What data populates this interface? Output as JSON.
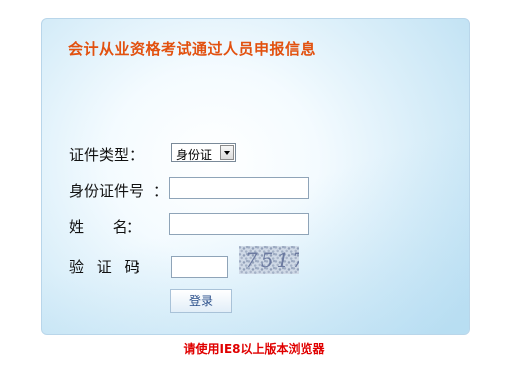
{
  "title": "会计从业资格考试通过人员申报信息",
  "form": {
    "cert_type_label": "证件类型：",
    "cert_type_value": "身份证",
    "id_number_label": "身份证件号",
    "id_number_colon": "：",
    "name_label": "姓 名",
    "name_colon": "：",
    "captcha_label": "验 证 码",
    "captcha_colon": "：",
    "captcha_code": "7517",
    "login_button": "登录"
  },
  "notice": "请使用IE8以上版本浏览器",
  "colors": {
    "title": "#e2510f",
    "notice": "#e00000",
    "panel_border": "#b9d6ea"
  }
}
